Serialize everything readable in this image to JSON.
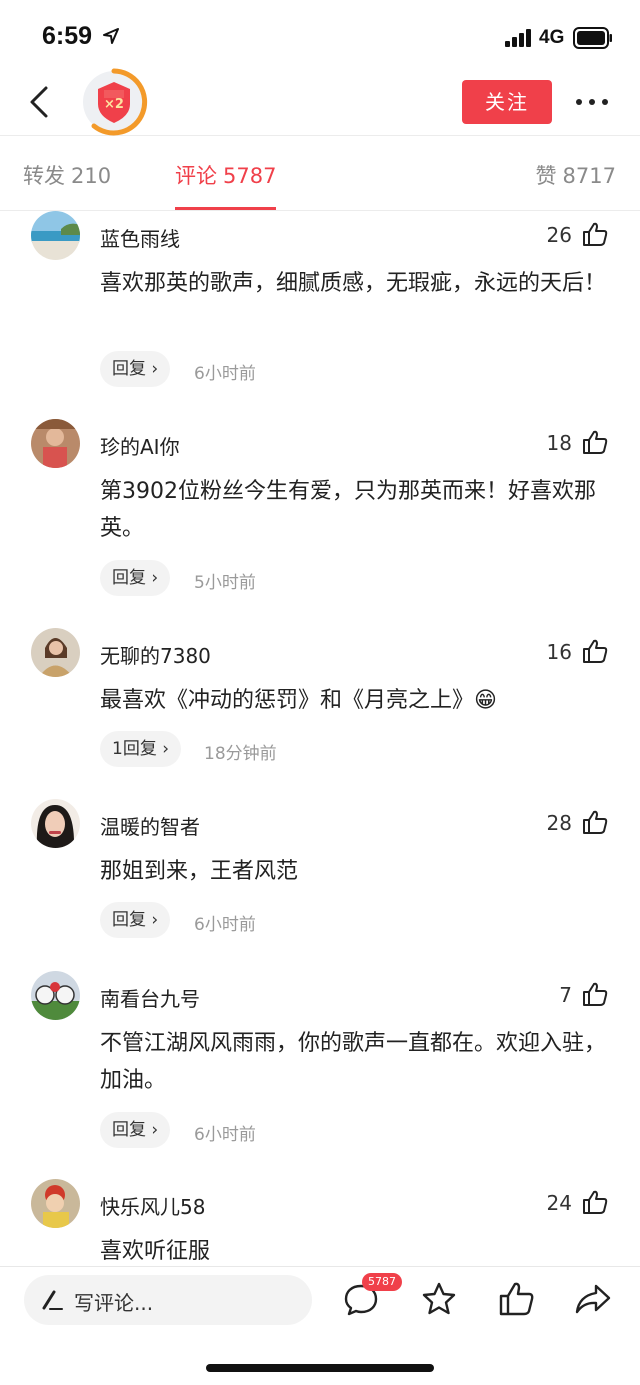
{
  "status_bar": {
    "time": "6:59",
    "network": "4G"
  },
  "header": {
    "badge_text": "×2",
    "follow_label": "关注"
  },
  "tabs": {
    "forward": {
      "label": "转发",
      "count": "210"
    },
    "comment": {
      "label": "评论",
      "count": "5787"
    },
    "like": {
      "label": "赞",
      "count": "8717"
    }
  },
  "comments": [
    {
      "name": "蓝色雨线",
      "likes": "26",
      "text": "喜欢那英的歌声，细腻质感，无瑕疵，永远的天后！",
      "reply_label": "回复",
      "time": "6小时前"
    },
    {
      "name": "珍的AI你",
      "likes": "18",
      "text": "第3902位粉丝今生有爱，只为那英而来！好喜欢那英。",
      "reply_label": "回复",
      "time": "5小时前"
    },
    {
      "name": "无聊的7380",
      "likes": "16",
      "text": "最喜欢《冲动的惩罚》和《月亮之上》😁",
      "reply_label": "1回复",
      "time": "18分钟前"
    },
    {
      "name": "温暖的智者",
      "likes": "28",
      "text": "那姐到来，王者风范",
      "reply_label": "回复",
      "time": "6小时前"
    },
    {
      "name": "南看台九号",
      "likes": "7",
      "text": "不管江湖风风雨雨，你的歌声一直都在。欢迎入驻，加油。",
      "reply_label": "回复",
      "time": "6小时前"
    },
    {
      "name": "快乐风儿58",
      "likes": "24",
      "text": "喜欢听征服",
      "reply_label": "",
      "time": ""
    }
  ],
  "bottom_bar": {
    "write_placeholder": "写评论...",
    "comment_badge": "5787"
  },
  "colors": {
    "accent": "#f0404a",
    "badge_ring": "#f39a2a"
  },
  "icons": [
    "back-arrow-icon",
    "more-dots-icon",
    "thumbs-up-icon",
    "pen-icon",
    "comment-bubble-icon",
    "star-icon",
    "share-icon"
  ]
}
